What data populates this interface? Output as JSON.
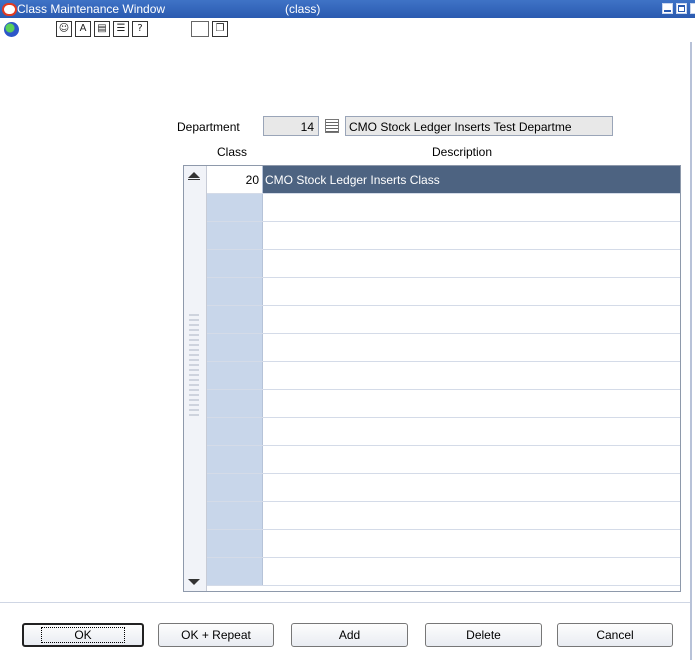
{
  "window": {
    "title": "Class Maintenance Window",
    "subtitle": "(class)"
  },
  "toolbar": {
    "icons": [
      "globe-icon",
      "spellcheck-icon",
      "find-icon",
      "copy-icon",
      "print-icon",
      "help-icon",
      "blank-icon",
      "new-document-icon"
    ],
    "glyphs": [
      "",
      "☺",
      "A",
      "▤",
      "☰",
      "?",
      "",
      "❐"
    ]
  },
  "department": {
    "label": "Department",
    "number": "14",
    "description": "CMO Stock Ledger Inserts Test Departme"
  },
  "grid": {
    "columns": [
      "Class",
      "Description"
    ],
    "rows": [
      {
        "class": "20",
        "description": "CMO Stock Ledger Inserts Class",
        "selected": true
      },
      {
        "class": "",
        "description": ""
      },
      {
        "class": "",
        "description": ""
      },
      {
        "class": "",
        "description": ""
      },
      {
        "class": "",
        "description": ""
      },
      {
        "class": "",
        "description": ""
      },
      {
        "class": "",
        "description": ""
      },
      {
        "class": "",
        "description": ""
      },
      {
        "class": "",
        "description": ""
      },
      {
        "class": "",
        "description": ""
      },
      {
        "class": "",
        "description": ""
      },
      {
        "class": "",
        "description": ""
      },
      {
        "class": "",
        "description": ""
      },
      {
        "class": "",
        "description": ""
      },
      {
        "class": "",
        "description": ""
      }
    ]
  },
  "buttons": {
    "ok": "OK",
    "ok_repeat": "OK + Repeat",
    "add": "Add",
    "delete": "Delete",
    "cancel": "Cancel"
  },
  "colors": {
    "titlebar": "#2a5ab0",
    "selected_row": "#4d6381",
    "class_cell": "#c8d6ea"
  }
}
